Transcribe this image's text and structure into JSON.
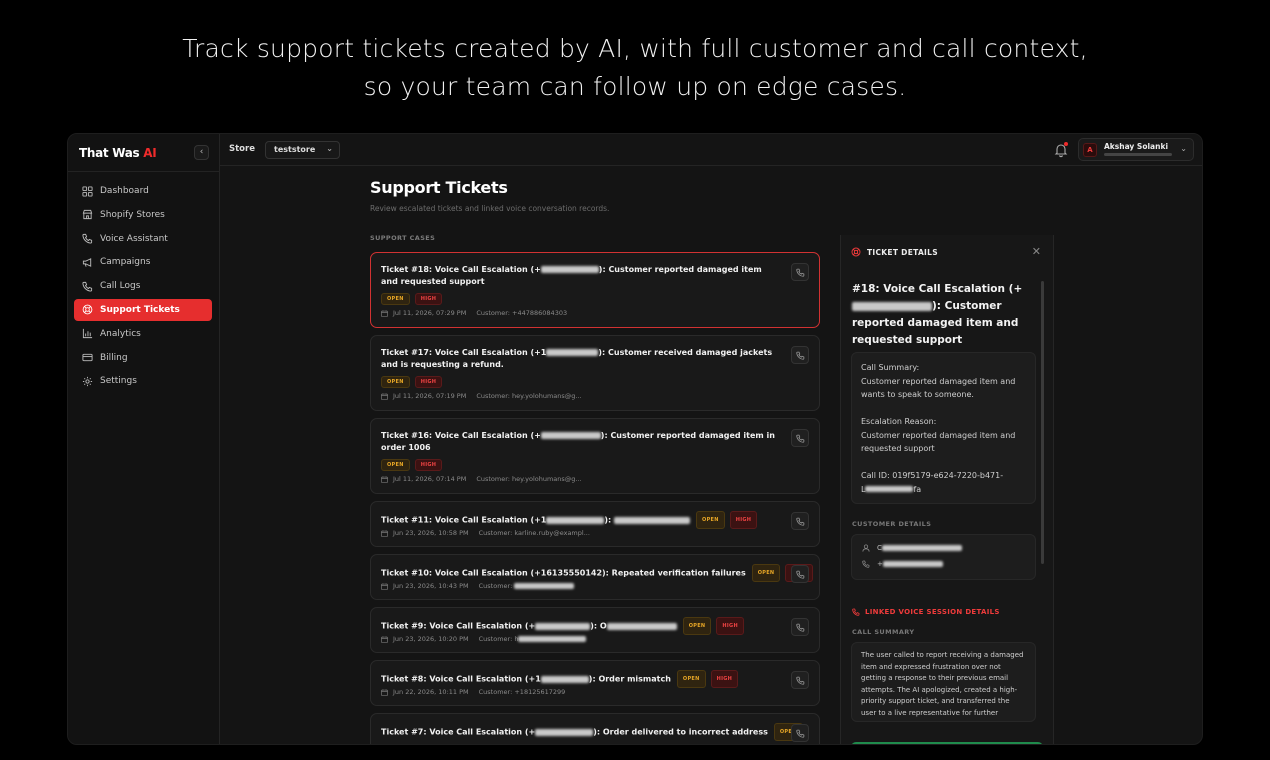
{
  "headline": {
    "line1": "Track support tickets created by AI, with full customer and call context,",
    "line2": "so your team can follow up on edge cases."
  },
  "brand": {
    "name": "That Was ",
    "accent": "AI"
  },
  "sidebar": {
    "items": [
      {
        "label": "Dashboard",
        "icon": "grid-icon"
      },
      {
        "label": "Shopify Stores",
        "icon": "store-icon"
      },
      {
        "label": "Voice Assistant",
        "icon": "phone-icon"
      },
      {
        "label": "Campaigns",
        "icon": "megaphone-icon"
      },
      {
        "label": "Call Logs",
        "icon": "phone-icon"
      },
      {
        "label": "Support Tickets",
        "icon": "lifebuoy-icon",
        "active": true
      },
      {
        "label": "Analytics",
        "icon": "bar-chart-icon"
      },
      {
        "label": "Billing",
        "icon": "card-icon"
      },
      {
        "label": "Settings",
        "icon": "gear-icon"
      }
    ]
  },
  "topbar": {
    "store_label": "Store",
    "store_value": "teststore",
    "user_name": "Akshay Solanki",
    "user_initial": "A"
  },
  "main": {
    "title": "Support Tickets",
    "subtitle": "Review escalated tickets and linked voice conversation records.",
    "section_label": "SUPPORT CASES"
  },
  "badges": {
    "open": "OPEN",
    "high": "HIGH"
  },
  "tickets": [
    {
      "prefix": "Ticket #18: Voice Call Escalation (+",
      "suffix": "): Customer reported damaged item and requested support",
      "date": "Jul 11, 2026, 07:29 PM",
      "customer": "Customer: +447886084303"
    },
    {
      "prefix": "Ticket #17: Voice Call Escalation (+1",
      "suffix": "): Customer received damaged jackets and is requesting a refund.",
      "date": "Jul 11, 2026, 07:19 PM",
      "customer": "Customer: hey.yolohumans@g..."
    },
    {
      "prefix": "Ticket #16: Voice Call Escalation (+",
      "suffix": "): Customer reported damaged item in order 1006",
      "date": "Jul 11, 2026, 07:14 PM",
      "customer": "Customer: hey.yolohumans@g..."
    },
    {
      "prefix": "Ticket #11: Voice Call Escalation (+1",
      "suffix": "):",
      "date": "Jun 23, 2026, 10:58 PM",
      "customer": "Customer: karline.ruby@exampl..."
    },
    {
      "prefix": "Ticket #10: Voice Call Escalation (+16135550142): Repeated verification failures",
      "suffix": "",
      "date": "Jun 23, 2026, 10:43 PM",
      "customer": "Customer:"
    },
    {
      "prefix": "Ticket #9: Voice Call Escalation (+",
      "suffix": "): O",
      "date": "Jun 23, 2026, 10:20 PM",
      "customer": "Customer: h"
    },
    {
      "prefix": "Ticket #8: Voice Call Escalation (+1",
      "suffix": "): Order mismatch",
      "date": "Jun 22, 2026, 10:11 PM",
      "customer": "Customer: +18125617299"
    },
    {
      "prefix": "Ticket #7: Voice Call Escalation (+",
      "suffix": "): Order delivered to incorrect address",
      "date": "",
      "customer": ""
    }
  ],
  "detail": {
    "header": "TICKET DETAILS",
    "title_a": "#18: Voice Call Escalation (+",
    "title_b": "): Customer reported damaged item and requested support",
    "summary_label": "Call Summary:",
    "summary_text": "Customer reported damaged item and wants to speak to someone.",
    "reason_label": "Escalation Reason:",
    "reason_text": "Customer reported damaged item and requested support",
    "call_id_a": "Call ID: 019f5179-e624-7220-b471-",
    "call_id_b": "L",
    "call_id_c": "fa",
    "customer_section": "CUSTOMER DETAILS",
    "customer_name_a": "C",
    "customer_phone_a": "+",
    "voice_section": "LINKED VOICE SESSION DETAILS",
    "call_summary_section": "CALL SUMMARY",
    "call_summary_text": "The user called to report receiving a damaged item and expressed frustration over not getting a response to their previous email attempts. The AI apologized, created a high-priority support ticket, and transferred the user to a live representative for further"
  }
}
